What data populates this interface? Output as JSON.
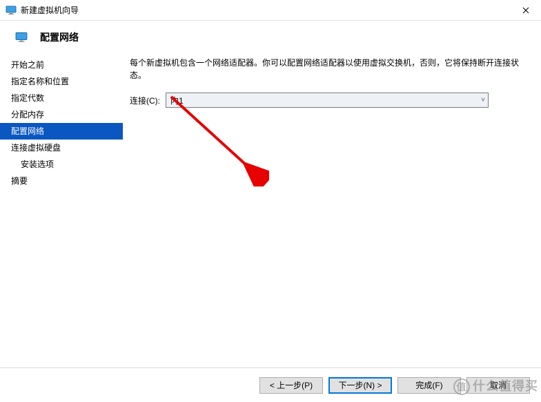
{
  "window": {
    "title": "新建虚拟机向导"
  },
  "header": {
    "title": "配置网络"
  },
  "sidebar": {
    "items": [
      {
        "label": "开始之前"
      },
      {
        "label": "指定名称和位置"
      },
      {
        "label": "指定代数"
      },
      {
        "label": "分配内存"
      },
      {
        "label": "配置网络"
      },
      {
        "label": "连接虚拟硬盘"
      },
      {
        "label": "安装选项"
      },
      {
        "label": "摘要"
      }
    ]
  },
  "main": {
    "description": "每个新虚拟机包含一个网络适配器。你可以配置网络适配器以使用虚拟交换机，否则，它将保持断开连接状态。",
    "connection_label": "连接(C):",
    "connection_value": "内1"
  },
  "footer": {
    "prev": "< 上一步(P)",
    "next": "下一步(N) >",
    "finish": "完成(F)",
    "cancel": "取消"
  },
  "watermark": "什么值得买"
}
